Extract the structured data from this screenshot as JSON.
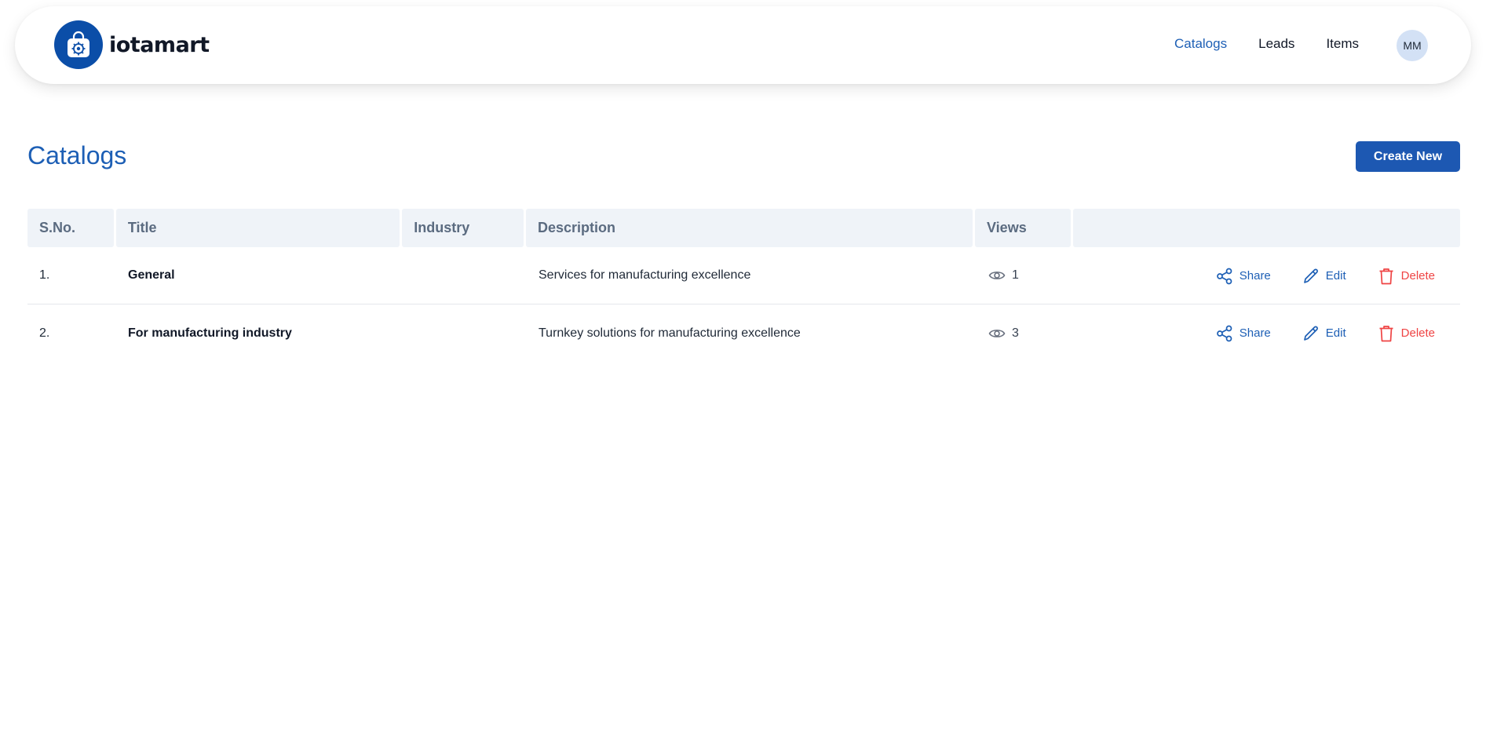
{
  "brand": {
    "name": "iotamart"
  },
  "nav": {
    "links": [
      {
        "label": "Catalogs",
        "active": true
      },
      {
        "label": "Leads"
      },
      {
        "label": "Items"
      }
    ],
    "avatar_initials": "MM"
  },
  "page": {
    "title": "Catalogs",
    "create_label": "Create New"
  },
  "table": {
    "headers": [
      "S.No.",
      "Title",
      "Industry",
      "Description",
      "Views",
      ""
    ],
    "rows": [
      {
        "sno": "1.",
        "title": "General",
        "industry": "",
        "description": "Services for manufacturing excellence",
        "views": "1"
      },
      {
        "sno": "2.",
        "title": "For manufacturing industry",
        "industry": "",
        "description": "Turnkey solutions for manufacturing excellence",
        "views": "3"
      }
    ],
    "actions": {
      "share": "Share",
      "edit": "Edit",
      "delete": "Delete"
    }
  },
  "colors": {
    "accent": "#1d5fb5",
    "button": "#1d58b2",
    "danger": "#ef4444",
    "header_bg": "#eff3f8"
  }
}
